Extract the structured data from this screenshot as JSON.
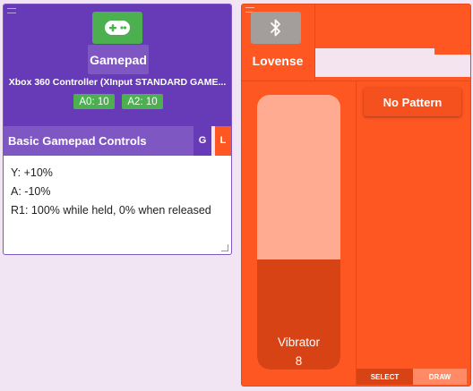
{
  "gamepad": {
    "name": "Gamepad",
    "controller": "Xbox 360 Controller (XInput STANDARD GAME...",
    "axes": [
      "A0: 10",
      "A2: 10"
    ],
    "section_title": "Basic Gamepad Controls",
    "tab_g": "G",
    "tab_l": "L",
    "lines": [
      "Y: +10%",
      "A: -10%",
      "R1: 100% while held, 0% when released"
    ]
  },
  "lovense": {
    "name": "Lovense",
    "slider_label": "Vibrator",
    "slider_value": "8",
    "level_fraction": 0.4,
    "pattern_button": "No Pattern",
    "select_label": "SELECT",
    "draw_label": "DRAW"
  },
  "colors": {
    "gamepad_header": "#673ab7",
    "gamepad_section": "#7e57c2",
    "accent_green": "#4caf50",
    "lovense_bg": "#ff5722",
    "slider_fill": "#d84315",
    "slider_track": "#ffab91"
  },
  "icons": {
    "gamepad_icon": "gamepad-icon",
    "bluetooth_icon": "bluetooth-icon"
  }
}
